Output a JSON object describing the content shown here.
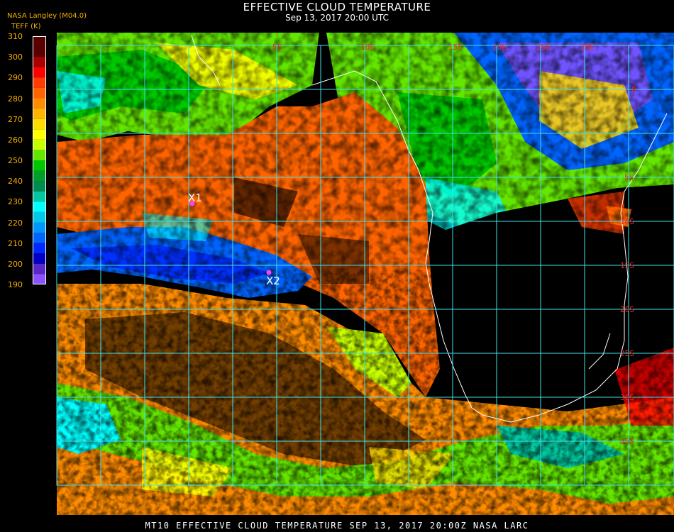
{
  "header": {
    "title": "EFFECTIVE CLOUD TEMPERATURE",
    "subtitle": "Sep 13, 2017 20:00 UTC",
    "org_label": "NASA Langley (M04.0)",
    "unit_label": "TEFF (K)"
  },
  "color_scale": {
    "ticks": [
      "310",
      "300",
      "290",
      "280",
      "270",
      "260",
      "250",
      "240",
      "230",
      "220",
      "210",
      "200",
      "190"
    ],
    "bands": [
      {
        "from": 300,
        "to": 310,
        "color": "#5a0000"
      },
      {
        "from": 295,
        "to": 300,
        "color": "#aa0000"
      },
      {
        "from": 290,
        "to": 295,
        "color": "#ff0000"
      },
      {
        "from": 285,
        "to": 290,
        "color": "#ff3c00"
      },
      {
        "from": 280,
        "to": 285,
        "color": "#ff6400"
      },
      {
        "from": 275,
        "to": 280,
        "color": "#ff8c00"
      },
      {
        "from": 270,
        "to": 275,
        "color": "#ffb400"
      },
      {
        "from": 265,
        "to": 270,
        "color": "#ffdc00"
      },
      {
        "from": 260,
        "to": 265,
        "color": "#ffff00"
      },
      {
        "from": 255,
        "to": 260,
        "color": "#c8ff00"
      },
      {
        "from": 250,
        "to": 255,
        "color": "#64e600"
      },
      {
        "from": 245,
        "to": 250,
        "color": "#00c800"
      },
      {
        "from": 240,
        "to": 245,
        "color": "#00a028"
      },
      {
        "from": 235,
        "to": 240,
        "color": "#008c50"
      },
      {
        "from": 230,
        "to": 235,
        "color": "#00c8a0"
      },
      {
        "from": 225,
        "to": 230,
        "color": "#00ffff"
      },
      {
        "from": 220,
        "to": 225,
        "color": "#00c8e6"
      },
      {
        "from": 215,
        "to": 220,
        "color": "#0096ff"
      },
      {
        "from": 210,
        "to": 215,
        "color": "#0064ff"
      },
      {
        "from": 205,
        "to": 210,
        "color": "#0028ff"
      },
      {
        "from": 200,
        "to": 205,
        "color": "#0000c8"
      },
      {
        "from": 195,
        "to": 200,
        "color": "#5a28c8"
      },
      {
        "from": 190,
        "to": 195,
        "color": "#8c50ff"
      }
    ]
  },
  "grid_labels": {
    "longitudes": [
      "5E",
      "10E",
      "15E",
      "20E",
      "25E",
      "30E"
    ],
    "latitudes": [
      "0",
      "5S",
      "10S",
      "15S",
      "20S",
      "25S",
      "30S",
      "35S"
    ]
  },
  "markers": [
    {
      "label": "X1",
      "color": "#ff3cff"
    },
    {
      "label": "X2",
      "color": "#ff3cff"
    }
  ],
  "footer": {
    "text": "MT10  EFFECTIVE CLOUD TEMPERATURE   SEP 13, 2017 20:00Z   NASA LARC"
  }
}
